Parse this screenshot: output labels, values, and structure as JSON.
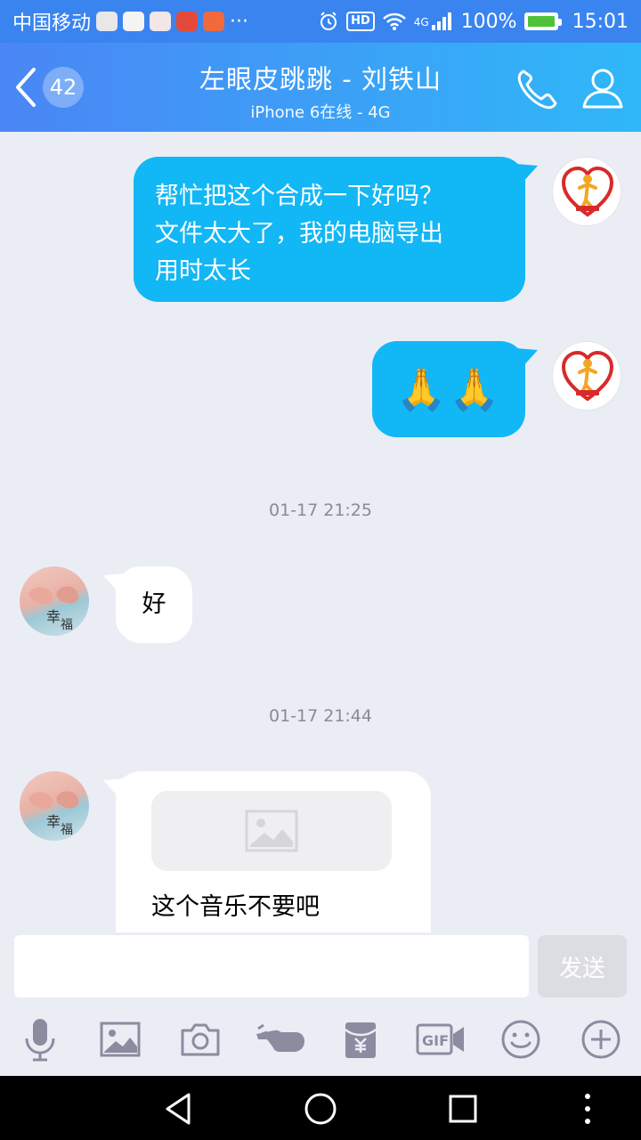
{
  "status_bar": {
    "carrier": "中国移动",
    "more": "···",
    "hd": "HD",
    "network": "4G",
    "battery": "100%",
    "time": "15:01"
  },
  "header": {
    "unread_count": "42",
    "title": "左眼皮跳跳 - 刘铁山",
    "subtitle": "iPhone 6在线 - 4G"
  },
  "messages": [
    {
      "direction": "out",
      "lines": [
        "帮忙把这个合成一下好吗？",
        "文件太大了，我的电脑导出",
        "用时太长"
      ]
    },
    {
      "direction": "out",
      "emoji": "🙏🙏"
    },
    {
      "timestamp": "01-17 21:25"
    },
    {
      "direction": "in",
      "text": "好"
    },
    {
      "timestamp": "01-17 21:44"
    },
    {
      "direction": "in",
      "image": "image-placeholder",
      "text": "这个音乐不要吧"
    }
  ],
  "input": {
    "value": "",
    "send_label": "发送"
  },
  "toolbar": [
    "microphone-icon",
    "image-icon",
    "camera-icon",
    "poke-icon",
    "red-packet-icon",
    "gif-icon",
    "emoji-icon",
    "plus-icon"
  ],
  "colors": {
    "header_start": "#4a86f5",
    "header_end": "#2fb8f8",
    "bubble_out": "#12b7f5",
    "bubble_in": "#ffffff",
    "background": "#ebedf5"
  }
}
